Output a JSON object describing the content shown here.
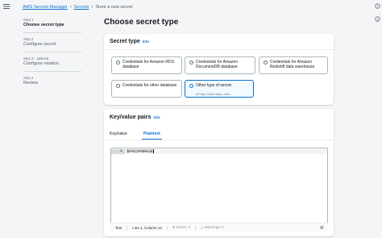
{
  "breadcrumb": {
    "items": [
      "AWS Secrets Manager",
      "Secrets",
      "Store a new secret"
    ]
  },
  "steps": [
    {
      "num": "Step 1",
      "title": "Choose secret type"
    },
    {
      "num": "Step 2",
      "title": "Configure secret"
    },
    {
      "num": "Step 3 - optional",
      "title": "Configure rotation"
    },
    {
      "num": "Step 4",
      "title": "Review"
    }
  ],
  "page_title": "Choose secret type",
  "secret_type": {
    "heading": "Secret type",
    "info": "Info",
    "options": [
      {
        "label": "Credentials for Amazon RDS database",
        "selected": false
      },
      {
        "label": "Credentials for Amazon DocumentDB database",
        "selected": false
      },
      {
        "label": "Credentials for Amazon Redshift data warehouse",
        "selected": false
      },
      {
        "label": "Credentials for other database",
        "selected": false
      },
      {
        "label": "Other type of secret",
        "desc": "API key, OAuth token, other.",
        "selected": true
      }
    ]
  },
  "kv": {
    "heading": "Key/value pairs",
    "info": "Info",
    "tabs": [
      "Key/value",
      "Plaintext"
    ],
    "active_tab": "Plaintext",
    "editor": {
      "line_number": "1",
      "content": "$PASSPHRASE"
    },
    "status": {
      "mode": "Text",
      "position": "Line 1, Column 12",
      "errors": "Errors: 0",
      "warnings": "Warnings: 0"
    }
  },
  "icons": {
    "menu": "hamburger-icon",
    "right_rail": [
      "notifications-icon",
      "info-circle-icon"
    ],
    "settings": "gear-icon"
  },
  "colors": {
    "accent": "#0972d3",
    "selected_tile_bg": "#f1faff"
  }
}
